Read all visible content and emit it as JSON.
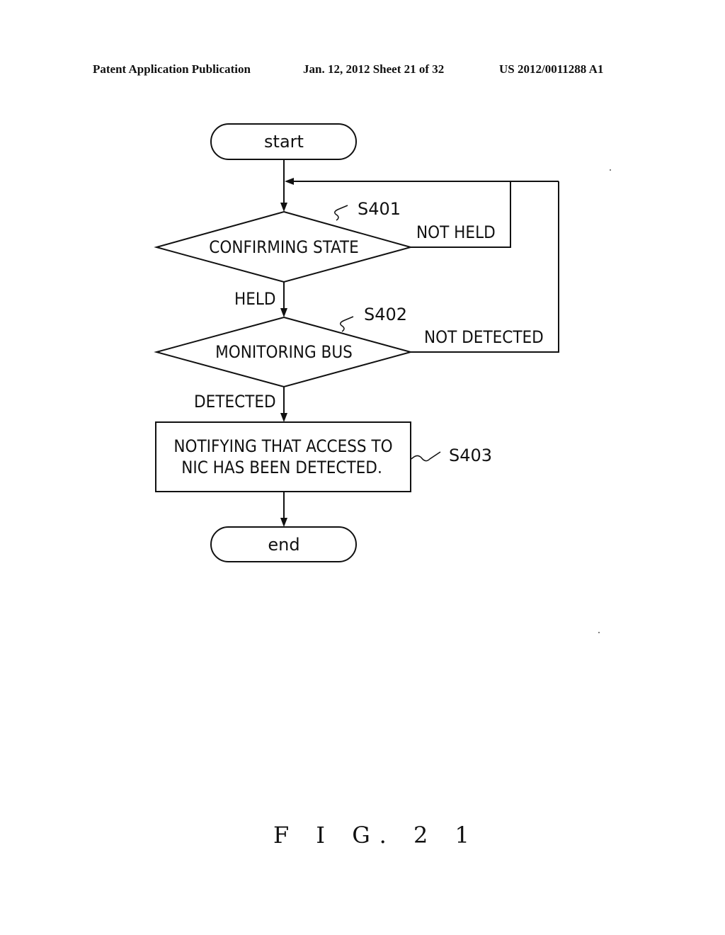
{
  "header": {
    "publication": "Patent Application Publication",
    "date_sheet": "Jan. 12, 2012  Sheet 21 of 32",
    "patent_number": "US 2012/0011288 A1"
  },
  "flowchart": {
    "start": "start",
    "end": "end",
    "steps": [
      {
        "id": "S401",
        "type": "decision",
        "text": "CONFIRMING STATE"
      },
      {
        "id": "S402",
        "type": "decision",
        "text": "MONITORING BUS"
      },
      {
        "id": "S403",
        "type": "process",
        "lines": [
          "NOTIFYING THAT ACCESS TO",
          "NIC HAS BEEN DETECTED."
        ]
      }
    ],
    "edges": {
      "s401_no": "NOT HELD",
      "s401_yes": "HELD",
      "s402_no": "NOT DETECTED",
      "s402_yes": "DETECTED"
    }
  },
  "figure_label": "F I G. 2 1"
}
